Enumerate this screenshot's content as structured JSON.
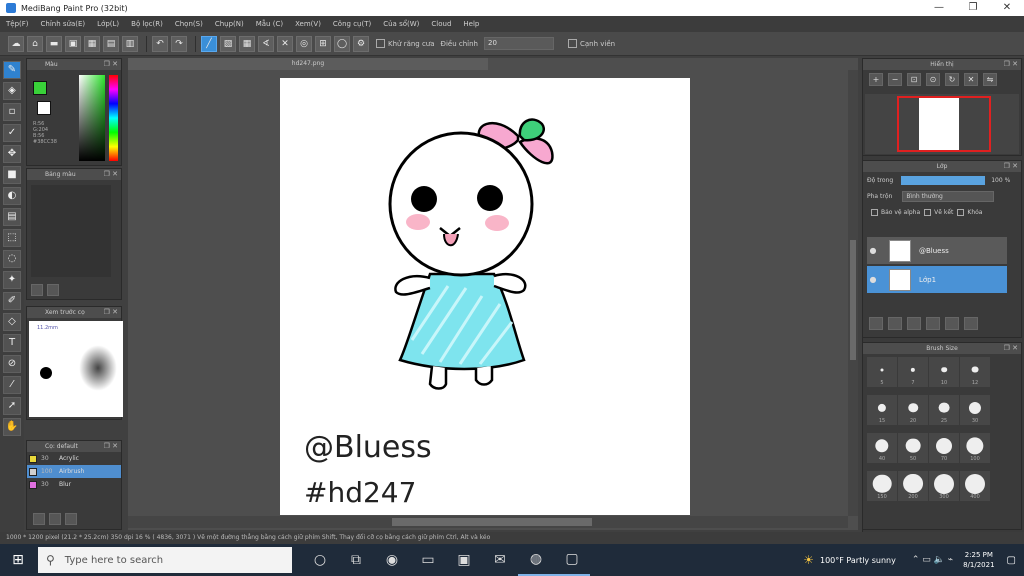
{
  "window": {
    "title": "MediBang Paint Pro (32bit)",
    "minimize": "—",
    "maximize": "❐",
    "close": "✕"
  },
  "menu": [
    "Tệp(F)",
    "Chỉnh sửa(E)",
    "Lớp(L)",
    "Bộ lọc(R)",
    "Chọn(S)",
    "Chụp(N)",
    "Mẫu (C)",
    "Xem(V)",
    "Công cụ(T)",
    "Của sổ(W)",
    "Cloud",
    "Help"
  ],
  "toolbar": {
    "auto_label": "Khử răng cưa",
    "correction_label": "Điều chỉnh",
    "correction_value": "20",
    "edge_label": "Cạnh viền"
  },
  "panels": {
    "color": {
      "title": "Màu",
      "values": "R:56\nG:204\nB:56\n#38CC38"
    },
    "palette": {
      "title": "Bảng màu"
    },
    "preview": {
      "title": "Xem trước cọ",
      "size": "11.2mm"
    },
    "brush": {
      "title": "Cọ: default",
      "items": [
        {
          "size": "30",
          "name": "Acrylic",
          "color": "#e8d83a"
        },
        {
          "size": "100",
          "name": "Airbrush",
          "color": "#d0d0d0"
        },
        {
          "size": "30",
          "name": "Blur",
          "color": "#e070e0"
        }
      ]
    },
    "navigator": {
      "title": "Hiển thị"
    },
    "layer": {
      "title": "Lớp",
      "opacity_label": "Độ trong",
      "opacity_value": "100 %",
      "blend_label": "Pha trộn",
      "blend_value": "Bình thường",
      "protect_label": "Bảo vệ alpha",
      "clip_label": "Vẽ kết",
      "lock_label": "Khóa",
      "layers": [
        {
          "name": "@Bluess"
        },
        {
          "name": "Lớp1"
        }
      ]
    },
    "brush_size": {
      "title": "Brush Size",
      "sizes": [
        "5",
        "7",
        "10",
        "12",
        "15",
        "20",
        "25",
        "30",
        "40",
        "50",
        "70",
        "100",
        "150",
        "200",
        "300",
        "400"
      ]
    }
  },
  "canvas": {
    "tab": "hd247.png",
    "text1": "@Bluess",
    "text2": "#hd247"
  },
  "status": "1000 * 1200 pixel  (21.2 * 25.2cm)  350 dpi  16 %  ( 4836, 3071 )  Vẽ một đường thẳng bằng cách giữ phím Shift, Thay đổi cỡ cọ bằng cách giữ phím Ctrl, Alt và kéo",
  "taskbar": {
    "search_placeholder": "Type here to search",
    "weather": "100°F  Partly sunny",
    "time": "2:25 PM",
    "date": "8/1/2021"
  }
}
